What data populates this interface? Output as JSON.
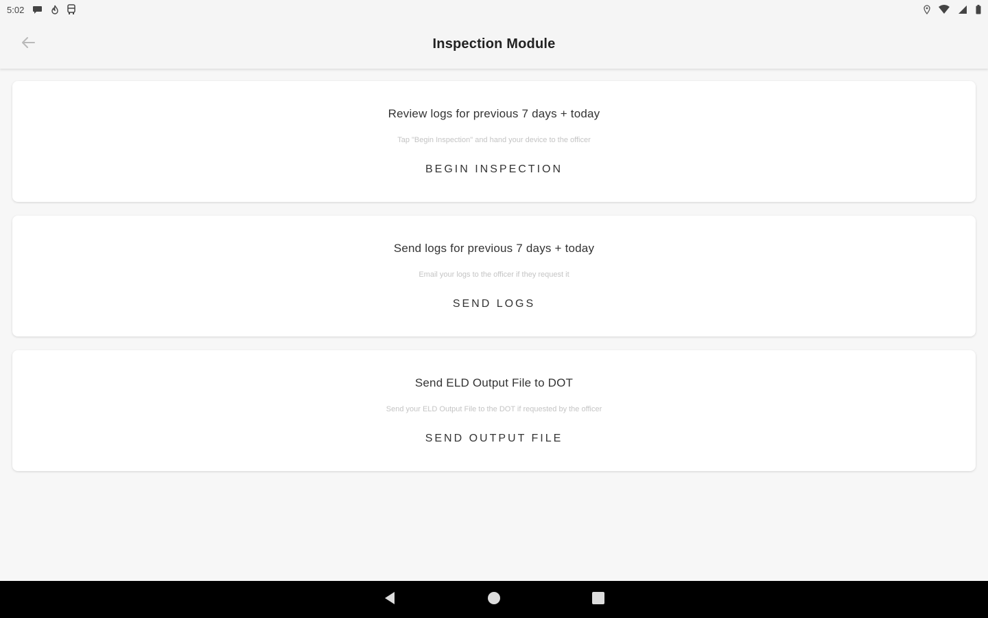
{
  "status_bar": {
    "time": "5:02",
    "left_icons": [
      "chat-icon",
      "flame-icon",
      "bus-icon"
    ],
    "right_icons": [
      "location-icon",
      "wifi-icon",
      "signal-icon",
      "battery-icon"
    ]
  },
  "header": {
    "title": "Inspection Module",
    "back_icon": "arrow-left-icon"
  },
  "cards": [
    {
      "title": "Review logs for previous 7 days + today",
      "subtitle": "Tap \"Begin Inspection\" and hand your device to the officer",
      "action": "BEGIN INSPECTION"
    },
    {
      "title": "Send logs for previous 7 days + today",
      "subtitle": "Email your logs to the officer if they request it",
      "action": "SEND LOGS"
    },
    {
      "title": "Send ELD Output File to DOT",
      "subtitle": "Send your ELD Output File to the DOT if requested by the officer",
      "action": "SEND OUTPUT FILE"
    }
  ],
  "nav_bar": {
    "icons": [
      "back-triangle-icon",
      "home-circle-icon",
      "recents-square-icon"
    ]
  },
  "colors": {
    "background": "#f7f7f7",
    "card": "#ffffff",
    "nav_bar": "#000000",
    "subtitle": "#c4c4c4"
  }
}
